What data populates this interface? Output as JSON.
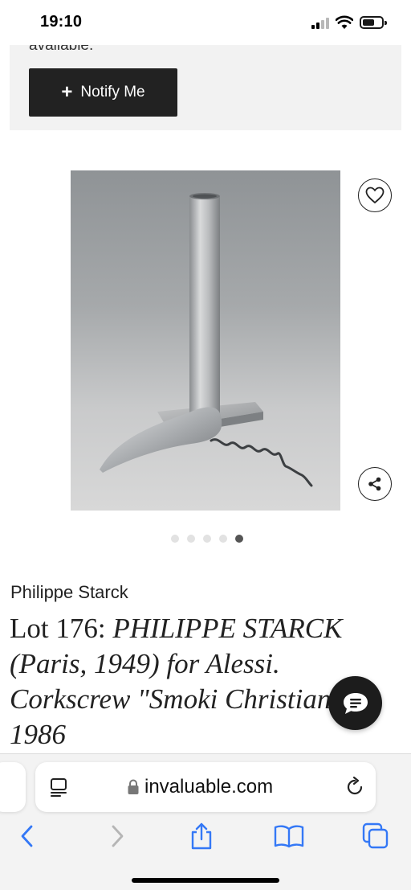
{
  "status_bar": {
    "time": "19:10"
  },
  "notify_panel": {
    "cutoff_text": "available.",
    "button_label": "Notify Me"
  },
  "carousel": {
    "dot_count": 5,
    "active_index": 4
  },
  "lot": {
    "artist": "Philippe Starck",
    "lot_prefix": "Lot 176: ",
    "title": "PHILIPPE STARCK (Paris, 1949) for Alessi. Corkscrew \"Smoki Christiani\". 1986"
  },
  "browser": {
    "url": "invaluable.com"
  },
  "icons": {
    "favorite": "heart-icon",
    "share": "share-icon",
    "chat": "chat-bubble-icon",
    "reader": "reader-mode-icon",
    "lock": "lock-icon",
    "reload": "reload-icon",
    "back": "chevron-left-icon",
    "forward": "chevron-right-icon",
    "share_sheet": "share-sheet-icon",
    "bookmarks": "book-icon",
    "tabs": "tabs-icon"
  },
  "colors": {
    "button_dark": "#222222",
    "panel_bg": "#f2f2f2",
    "safari_blue": "#3478f6",
    "chat_bg": "#1c1c1c"
  }
}
